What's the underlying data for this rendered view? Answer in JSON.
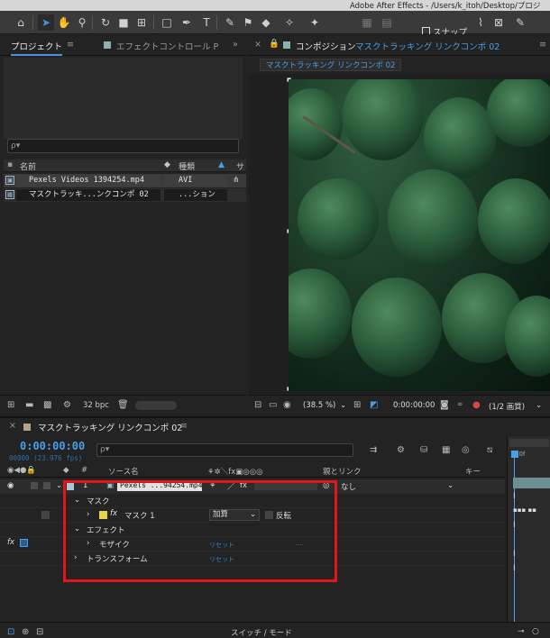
{
  "titlebar": {
    "text": "Adobe After Effects - /Users/k_itoh/Desktop/プロジ"
  },
  "toolbar": {
    "snap_label": "スナップ"
  },
  "project": {
    "tab_project": "プロジェクト",
    "tab_effect": "エフェクトコントロール P",
    "search_placeholder": "ρ▾",
    "col_name": "名前",
    "col_type": "種類",
    "rows": [
      {
        "name": "Pexels Videos 1394254.mp4",
        "type": "AVI"
      },
      {
        "name": "マスクトラッキ...ンクコンポ 02",
        "type": "...ション"
      }
    ],
    "bpc": "32 bpc"
  },
  "comp": {
    "tab_label": "コンポジション",
    "tab_comp_name": "マスクトラッキング リンクコンポ 02",
    "subtab": "マスクトラッキング リンクコンポ 02",
    "zoom": "(38.5 %)",
    "timecode": "0:00:00:00",
    "quality": "(1/2 画質)"
  },
  "timeline": {
    "tab": "マスクトラッキング リンクコンポ 02",
    "time": "0:00:00:00",
    "fps": "00000 (23.976 fps)",
    "search_placeholder": "ρ▾",
    "col_source": "ソース名",
    "col_parent": "親とリンク",
    "col_key": "キー",
    "layer_num": "1",
    "layer_name": "Pexels ...94254.mp4",
    "parent_value": "なし",
    "mask_group": "マスク",
    "mask_item": "マスク 1",
    "mask_mode": "加算",
    "mask_invert": "反転",
    "effect_group": "エフェクト",
    "mosaic": "モザイク",
    "mosaic_reset": "リセット",
    "mosaic_dots": "....",
    "transform": "トランスフォーム",
    "transform_reset": "リセット",
    "footer_switch": "スイッチ / モード",
    "ruler_label": "00f"
  },
  "colors": {
    "accent": "#4a9fe8",
    "highlight_box": "#e4141b"
  }
}
